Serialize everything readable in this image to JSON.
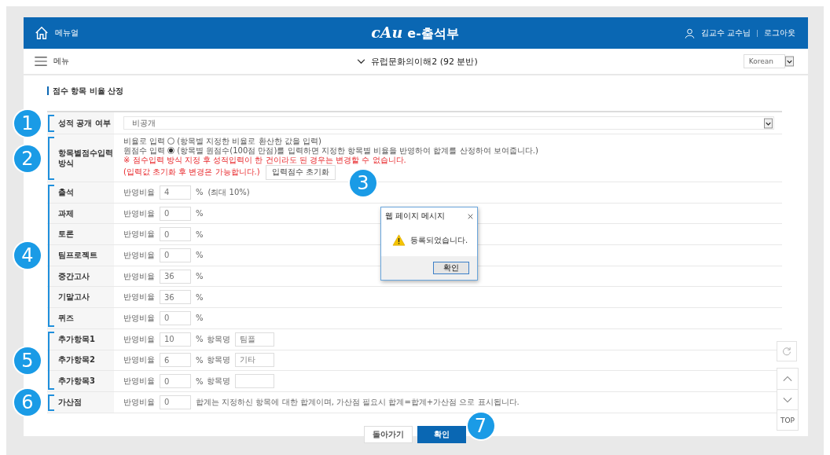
{
  "header": {
    "manual": "메뉴얼",
    "logo_mark": "cAu",
    "logo_text": "e-출석부",
    "user": "김교수 교수님",
    "logout": "로그아웃"
  },
  "subnav": {
    "menu": "메뉴",
    "course": "유럽문화의이해2 (92 분반)",
    "language": "Korean"
  },
  "section_title": "점수 항목 비율 산정",
  "disclosure": {
    "marker": "1",
    "label": "성적 공개 여부",
    "value": "비공개"
  },
  "input_method": {
    "marker": "2",
    "label": "항목별점수입력 방식",
    "options": [
      {
        "label": "비율로 입력",
        "description": "(항목별 지정한 비율로 환산한 값을 입력)",
        "selected": false
      },
      {
        "label": "원점수 입력",
        "description": "(항목별 원점수(100점 만점)를 입력하면 지정한 항목별 비율을 반영하여 합계를 산정하여 보여줍니다.)",
        "selected": true
      }
    ],
    "warning": "※ 점수입력 방식 지정 후 성적입력이 한 건이라도 된 경우는 변경할 수 없습니다.",
    "note": "(입력값 초기화 후 변경은 가능합니다.)",
    "reset_button": {
      "label": "입력점수 초기화",
      "marker": "3"
    }
  },
  "item_groups": [
    {
      "marker": "4",
      "items": [
        {
          "kind": "percent",
          "label": "출석",
          "ratio_label": "반영비율",
          "value": "4",
          "unit": "%",
          "hint": "(최대 10%)"
        },
        {
          "kind": "percent",
          "label": "과제",
          "ratio_label": "반영비율",
          "value": "0",
          "unit": "%"
        },
        {
          "kind": "percent",
          "label": "토론",
          "ratio_label": "반영비율",
          "value": "0",
          "unit": "%"
        },
        {
          "kind": "percent",
          "label": "팀프로젝트",
          "ratio_label": "반영비율",
          "value": "0",
          "unit": "%"
        },
        {
          "kind": "percent",
          "label": "중간고사",
          "ratio_label": "반영비율",
          "value": "36",
          "unit": "%"
        },
        {
          "kind": "percent",
          "label": "기말고사",
          "ratio_label": "반영비율",
          "value": "36",
          "unit": "%"
        },
        {
          "kind": "percent",
          "label": "퀴즈",
          "ratio_label": "반영비율",
          "value": "0",
          "unit": "%"
        }
      ]
    },
    {
      "marker": "5",
      "items": [
        {
          "kind": "named",
          "label": "추가항목1",
          "ratio_label": "반영비율",
          "value": "10",
          "unit": "%",
          "name_label": "항목명",
          "name_value": "팀플"
        },
        {
          "kind": "named",
          "label": "추가항목2",
          "ratio_label": "반영비율",
          "value": "6",
          "unit": "%",
          "name_label": "항목명",
          "name_value": "기타"
        },
        {
          "kind": "named",
          "label": "추가항목3",
          "ratio_label": "반영비율",
          "value": "0",
          "unit": "%",
          "name_label": "항목명"
        }
      ]
    },
    {
      "marker": "6",
      "items": [
        {
          "kind": "bonus",
          "label": "가산점",
          "ratio_label": "반영비율",
          "value": "0",
          "hint": "합계는 지정하신 항목에 대한 합계이며, 가산점 필요시 합계=합계+가산점 으로 표시됩니다."
        }
      ]
    }
  ],
  "buttons": [
    {
      "label": "돌아가기",
      "primary": false
    },
    {
      "label": "확인",
      "primary": true,
      "marker": "7"
    }
  ],
  "side_buttons": {
    "top": "TOP"
  },
  "dialog": {
    "title": "웹 페이지 메시지",
    "message": "등록되었습니다.",
    "button": "확인"
  }
}
